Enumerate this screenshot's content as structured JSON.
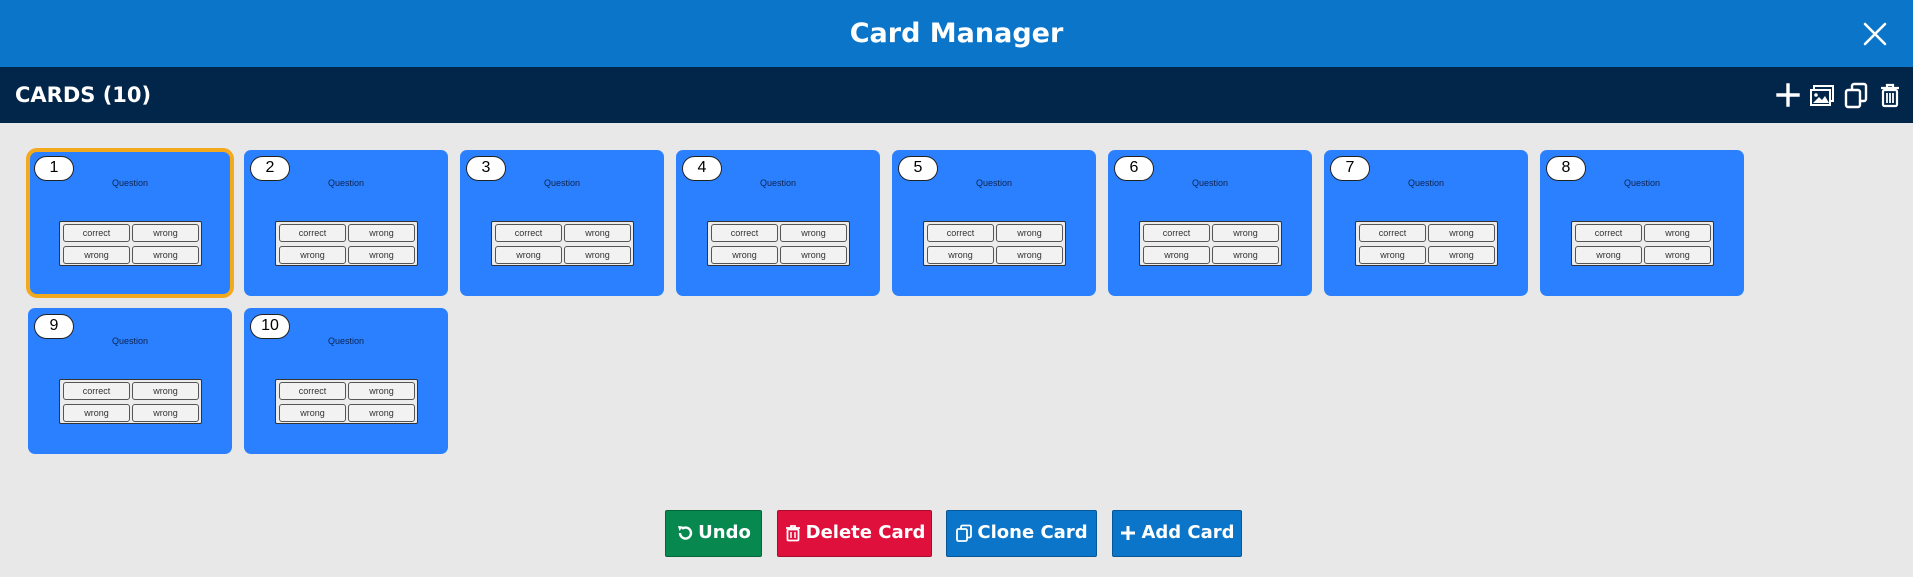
{
  "window": {
    "title": "Card Manager"
  },
  "toolbar": {
    "label": "CARDS (10)"
  },
  "cards": [
    {
      "number": "1",
      "question": "Question",
      "answers": [
        "correct",
        "wrong",
        "wrong",
        "wrong"
      ],
      "selected": true
    },
    {
      "number": "2",
      "question": "Question",
      "answers": [
        "correct",
        "wrong",
        "wrong",
        "wrong"
      ],
      "selected": false
    },
    {
      "number": "3",
      "question": "Question",
      "answers": [
        "correct",
        "wrong",
        "wrong",
        "wrong"
      ],
      "selected": false
    },
    {
      "number": "4",
      "question": "Question",
      "answers": [
        "correct",
        "wrong",
        "wrong",
        "wrong"
      ],
      "selected": false
    },
    {
      "number": "5",
      "question": "Question",
      "answers": [
        "correct",
        "wrong",
        "wrong",
        "wrong"
      ],
      "selected": false
    },
    {
      "number": "6",
      "question": "Question",
      "answers": [
        "correct",
        "wrong",
        "wrong",
        "wrong"
      ],
      "selected": false
    },
    {
      "number": "7",
      "question": "Question",
      "answers": [
        "correct",
        "wrong",
        "wrong",
        "wrong"
      ],
      "selected": false
    },
    {
      "number": "8",
      "question": "Question",
      "answers": [
        "correct",
        "wrong",
        "wrong",
        "wrong"
      ],
      "selected": false
    },
    {
      "number": "9",
      "question": "Question",
      "answers": [
        "correct",
        "wrong",
        "wrong",
        "wrong"
      ],
      "selected": false
    },
    {
      "number": "10",
      "question": "Question",
      "answers": [
        "correct",
        "wrong",
        "wrong",
        "wrong"
      ],
      "selected": false
    }
  ],
  "buttons": {
    "undo": "Undo",
    "delete": "Delete Card",
    "clone": "Clone Card",
    "add": "Add Card"
  },
  "icons": {
    "close": "close-icon",
    "add": "plus-icon",
    "image": "image-icon",
    "clone": "clone-icon",
    "delete": "trash-icon",
    "undo": "undo-icon"
  },
  "colors": {
    "title_bar": "#0a75c9",
    "toolbar": "#02264a",
    "card": "#2b80ff",
    "selected_outline": "#f2a91e",
    "undo": "#07884f",
    "delete": "#e0103c",
    "clone": "#0a75c9",
    "add": "#0a75c9"
  }
}
